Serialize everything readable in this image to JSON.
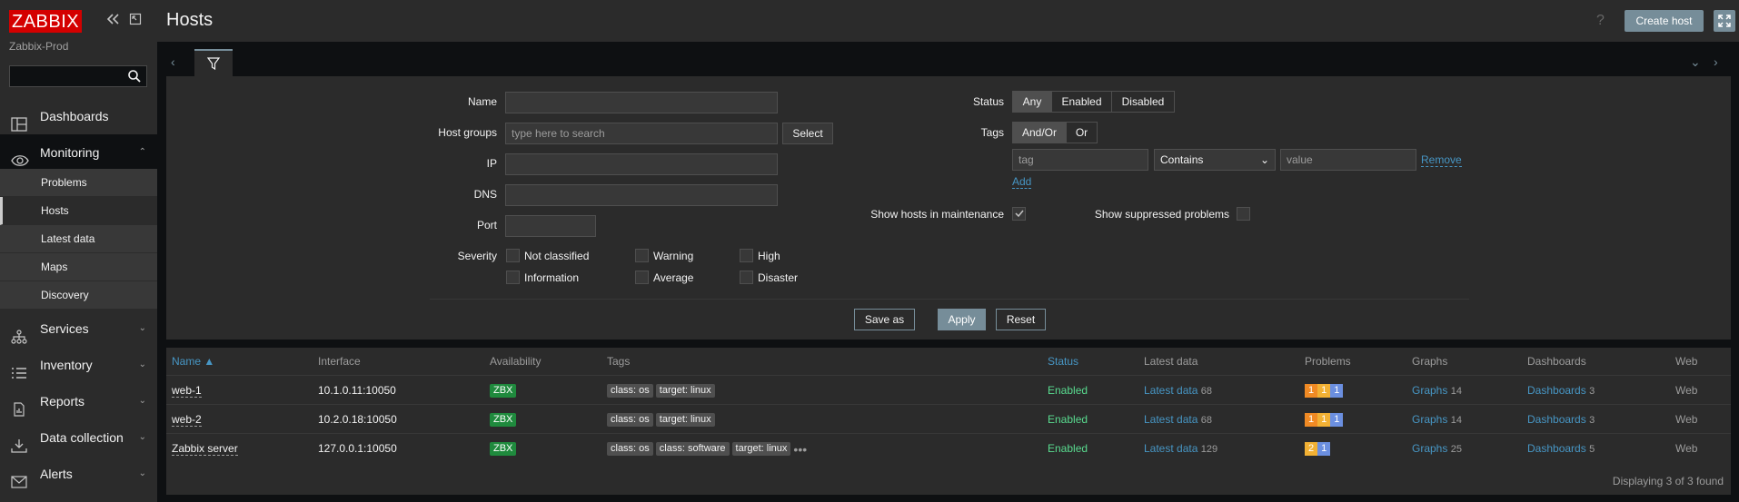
{
  "sidebar": {
    "logo_text": "ZABBIX",
    "server_name": "Zabbix-Prod",
    "search_value": "",
    "nav": [
      {
        "label": "Dashboards",
        "icon": "dashboards-icon"
      },
      {
        "label": "Monitoring",
        "icon": "eye-icon"
      },
      {
        "label": "Services",
        "icon": "services-icon"
      },
      {
        "label": "Inventory",
        "icon": "list-icon"
      },
      {
        "label": "Reports",
        "icon": "reports-icon"
      },
      {
        "label": "Data collection",
        "icon": "download-icon"
      },
      {
        "label": "Alerts",
        "icon": "envelope-icon"
      }
    ],
    "monitoring_sub": [
      "Problems",
      "Hosts",
      "Latest data",
      "Maps",
      "Discovery"
    ]
  },
  "header": {
    "title": "Hosts",
    "help": "?",
    "create_label": "Create host"
  },
  "filter": {
    "name_label": "Name",
    "name_value": "",
    "hostgroups_label": "Host groups",
    "hostgroups_placeholder": "type here to search",
    "select_label": "Select",
    "ip_label": "IP",
    "dns_label": "DNS",
    "port_label": "Port",
    "severity_label": "Severity",
    "severities": [
      "Not classified",
      "Warning",
      "High",
      "Information",
      "Average",
      "Disaster"
    ],
    "status_label": "Status",
    "status_options": [
      "Any",
      "Enabled",
      "Disabled"
    ],
    "status_selected": "Any",
    "tags_label": "Tags",
    "tags_options": [
      "And/Or",
      "Or"
    ],
    "tags_selected": "And/Or",
    "tag_placeholder": "tag",
    "tag_operator": "Contains",
    "value_placeholder": "value",
    "remove_label": "Remove",
    "add_label": "Add",
    "maintenance_label": "Show hosts in maintenance",
    "maintenance_checked": true,
    "suppressed_label": "Show suppressed problems",
    "suppressed_checked": false,
    "saveas_label": "Save as",
    "apply_label": "Apply",
    "reset_label": "Reset"
  },
  "table": {
    "columns": [
      "Name ▲",
      "Interface",
      "Availability",
      "Tags",
      "Status",
      "Latest data",
      "Problems",
      "Graphs",
      "Dashboards",
      "Web"
    ],
    "rows": [
      {
        "name": "web-1",
        "interface": "10.1.0.11:10050",
        "availability": "ZBX",
        "tags": [
          "class: os",
          "target: linux"
        ],
        "more_tags": false,
        "status": "Enabled",
        "latest": "Latest data",
        "latest_count": "68",
        "problems": [
          {
            "v": "1",
            "c": "#f08a24"
          },
          {
            "v": "1",
            "c": "#f2b134"
          },
          {
            "v": "1",
            "c": "#6b8fe0"
          }
        ],
        "graphs": "Graphs",
        "graphs_count": "14",
        "dashboards": "Dashboards",
        "dashboards_count": "3",
        "web": "Web"
      },
      {
        "name": "web-2",
        "interface": "10.2.0.18:10050",
        "availability": "ZBX",
        "tags": [
          "class: os",
          "target: linux"
        ],
        "more_tags": false,
        "status": "Enabled",
        "latest": "Latest data",
        "latest_count": "68",
        "problems": [
          {
            "v": "1",
            "c": "#f08a24"
          },
          {
            "v": "1",
            "c": "#f2b134"
          },
          {
            "v": "1",
            "c": "#6b8fe0"
          }
        ],
        "graphs": "Graphs",
        "graphs_count": "14",
        "dashboards": "Dashboards",
        "dashboards_count": "3",
        "web": "Web"
      },
      {
        "name": "Zabbix server",
        "interface": "127.0.0.1:10050",
        "availability": "ZBX",
        "tags": [
          "class: os",
          "class: software",
          "target: linux"
        ],
        "more_tags": true,
        "status": "Enabled",
        "latest": "Latest data",
        "latest_count": "129",
        "problems": [
          {
            "v": "2",
            "c": "#f2b134"
          },
          {
            "v": "1",
            "c": "#6b8fe0"
          }
        ],
        "graphs": "Graphs",
        "graphs_count": "25",
        "dashboards": "Dashboards",
        "dashboards_count": "5",
        "web": "Web"
      }
    ],
    "footer": "Displaying 3 of 3 found"
  },
  "colors": {
    "accent": "#768d99",
    "link": "#4796c4",
    "enabled": "#59db8f",
    "zbx": "#1f8a3d",
    "brand": "#d40000"
  }
}
